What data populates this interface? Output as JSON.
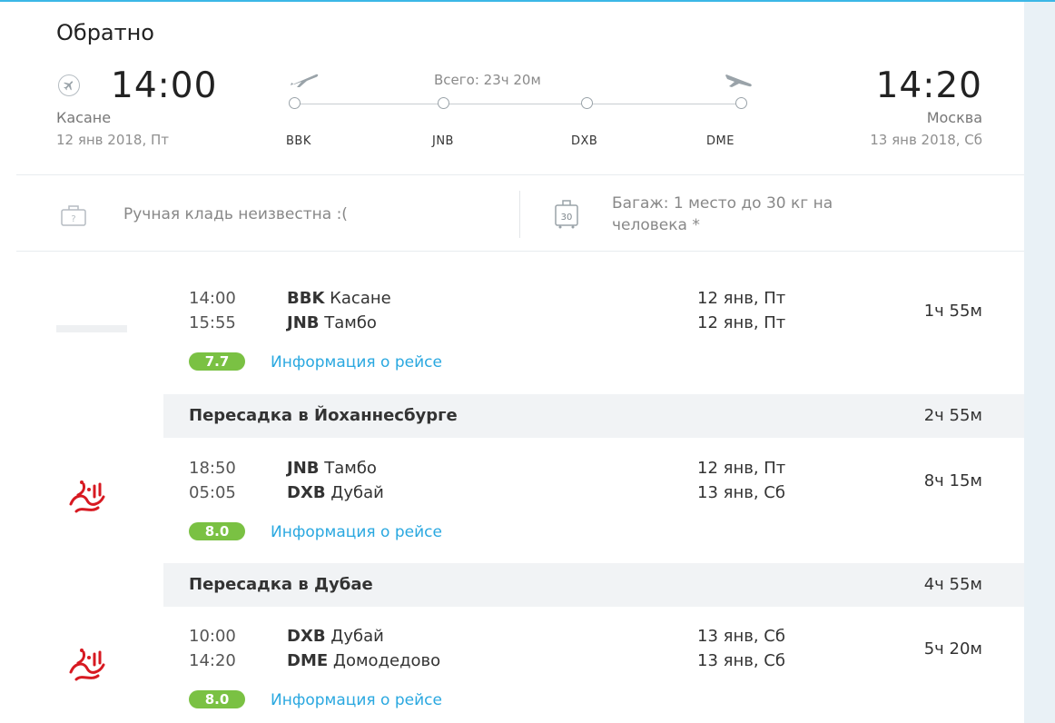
{
  "header": {
    "title": "Обратно"
  },
  "overview": {
    "departure": {
      "time": "14:00",
      "city": "Касане",
      "date": "12 янв 2018, Пт"
    },
    "arrival": {
      "time": "14:20",
      "city": "Москва",
      "date": "13 янв 2018, Сб"
    },
    "total_label": "Всего: 23ч 20м",
    "airports": [
      "BBK",
      "JNB",
      "DXB",
      "DME"
    ]
  },
  "baggage": {
    "hand": "Ручная кладь неизвестна :(",
    "checked_line1": "Багаж: 1 место до 30 кг на",
    "checked_line2": "человека *",
    "checked_icon_text": "30"
  },
  "segments": [
    {
      "dep_time": "14:00",
      "dep_code": "BBK",
      "dep_name": "Касане",
      "dep_date": "12 янв, Пт",
      "arr_time": "15:55",
      "arr_code": "JNB",
      "arr_name": "Тамбо",
      "arr_date": "12 янв, Пт",
      "duration": "1ч 55м",
      "rating": "7.7",
      "info_link": "Информация о рейсе"
    },
    {
      "dep_time": "18:50",
      "dep_code": "JNB",
      "dep_name": "Тамбо",
      "dep_date": "12 янв, Пт",
      "arr_time": "05:05",
      "arr_code": "DXB",
      "arr_name": "Дубай",
      "arr_date": "13 янв, Сб",
      "duration": "8ч 15м",
      "rating": "8.0",
      "info_link": "Информация о рейсе"
    },
    {
      "dep_time": "10:00",
      "dep_code": "DXB",
      "dep_name": "Дубай",
      "dep_date": "13 янв, Сб",
      "arr_time": "14:20",
      "arr_code": "DME",
      "arr_name": "Домодедово",
      "arr_date": "13 янв, Сб",
      "duration": "5ч 20м",
      "rating": "8.0",
      "info_link": "Информация о рейсе"
    }
  ],
  "layovers": [
    {
      "label": "Пересадка в Йоханнесбурге",
      "duration": "2ч 55м"
    },
    {
      "label": "Пересадка в Дубае",
      "duration": "4ч 55м"
    }
  ],
  "colors": {
    "accent": "#2aa8e0",
    "rating": "#7ac143",
    "airline_logo": "#d71921"
  }
}
